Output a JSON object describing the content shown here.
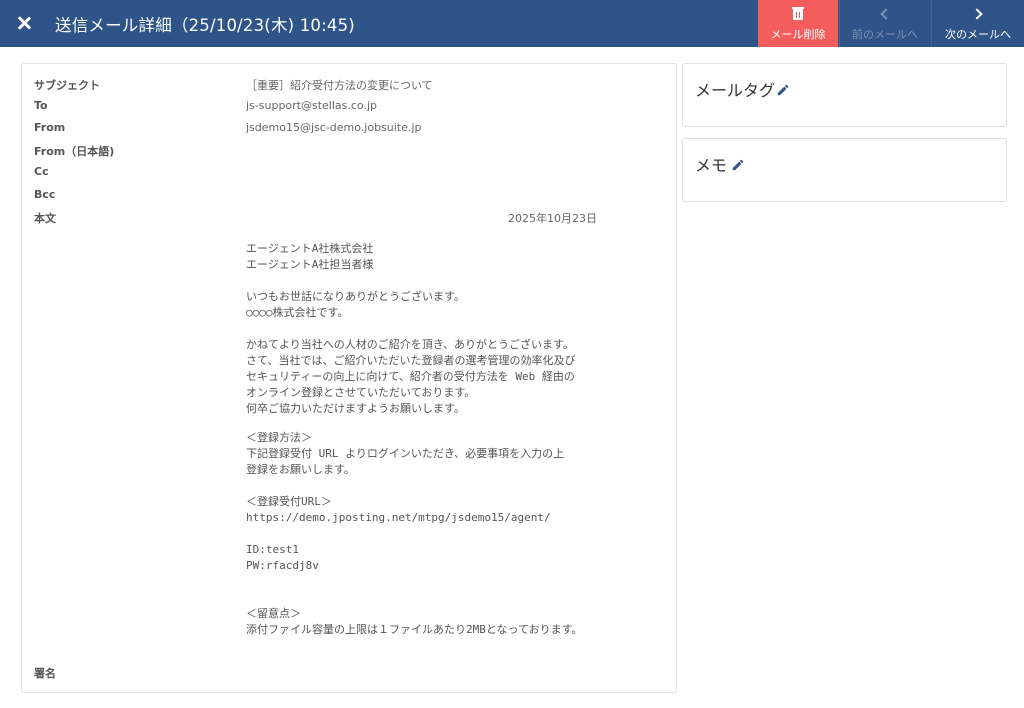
{
  "header": {
    "title": "送信メール詳細（25/10/23(木) 10:45)",
    "delete_label": "メール削除",
    "prev_label": "前のメールへ",
    "next_label": "次のメールへ",
    "bg_color": "#2e5488",
    "delete_color": "#f55d5d"
  },
  "mail": {
    "fields": [
      {
        "label": "サブジェクト",
        "value": "［重要］紹介受付方法の変更について"
      },
      {
        "label": "To",
        "value": "js-support@stellas.co.jp"
      },
      {
        "label": "From",
        "value": "jsdemo15@jsc-demo.jobsuite.jp"
      },
      {
        "label": "From（日本語)",
        "value": ""
      },
      {
        "label": "Cc",
        "value": ""
      },
      {
        "label": "Bcc",
        "value": ""
      },
      {
        "label": "本文",
        "value": ""
      }
    ],
    "date": "2025年10月23日",
    "body_1": "エージェントA社株式会社\nエージェントA社担当者様\n\nいつもお世話になりありがとうございます。\n○○○○株式会社です。\n\nかねてより当社への人材のご紹介を頂き、ありがとうございます。\nさて、当社では、ご紹介いただいた登録者の選考管理の効率化及び\nセキュリティーの向上に向けて、紹介者の受付方法を Web 経由の\nオンライン登録とさせていただいております。\n何卒ご協力いただけますようお願いします。",
    "body_2": "＜登録方法＞\n下記登録受付 URL よりログインいただき、必要事項を入力の上\n登録をお願いします。\n\n＜登録受付URL＞\nhttps://demo.jposting.net/mtpg/jsdemo15/agent/\n\nID:test1\nPW:rfacdj8v\n\n\n＜留意点＞\n添付ファイル容量の上限は１ファイルあたり2MBとなっております。",
    "signature_label": "署名"
  },
  "sidebar": {
    "tag_title": "メールタグ",
    "memo_title": "メモ",
    "pencil_icon": "pencil-icon",
    "accent": "#2e5488"
  }
}
